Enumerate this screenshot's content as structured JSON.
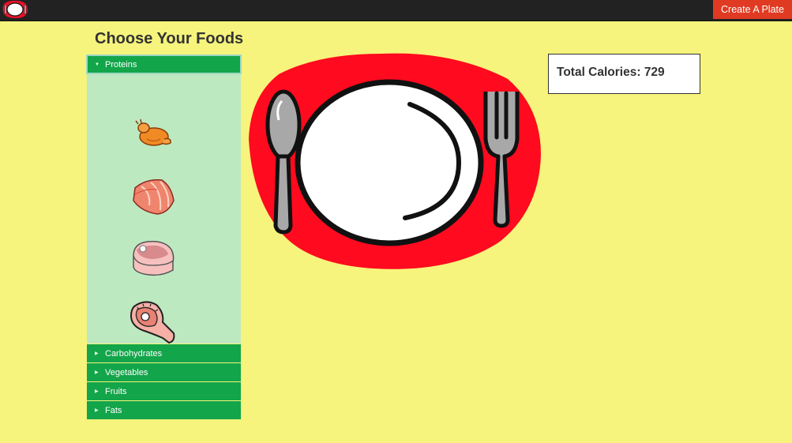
{
  "header": {
    "logo": "plate-logo-icon",
    "create_button_label": "Create A Plate",
    "bar_color": "#222222",
    "button_color": "#e03a22"
  },
  "sidebar": {
    "title": "Choose Your Foods",
    "categories": [
      {
        "label": "Proteins",
        "expanded": true
      },
      {
        "label": "Carbohydrates",
        "expanded": false
      },
      {
        "label": "Vegetables",
        "expanded": false
      },
      {
        "label": "Fruits",
        "expanded": false
      },
      {
        "label": "Fats",
        "expanded": false
      }
    ],
    "protein_items": [
      "roast-chicken-icon",
      "salmon-fillet-icon",
      "ham-slice-icon",
      "steak-icon"
    ],
    "header_color": "#13a54a",
    "panel_color": "#bde9c0"
  },
  "plate": {
    "placemat_color": "#ff0a1e",
    "icons": [
      "spoon-icon",
      "plate-icon",
      "fork-icon"
    ]
  },
  "calories": {
    "label": "Total Calories: 729"
  },
  "page_background": "#f6f47c"
}
